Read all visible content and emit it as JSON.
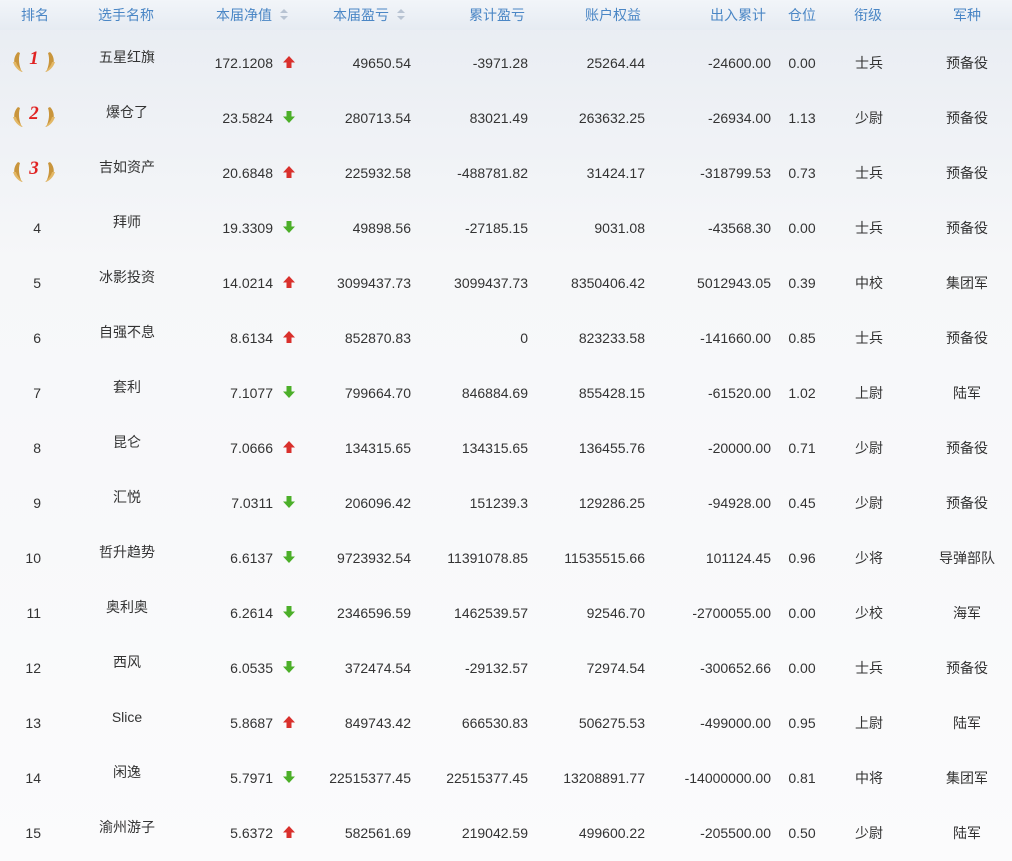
{
  "headers": {
    "rank": "排名",
    "name": "选手名称",
    "nav": "本届净值",
    "pnl": "本届盈亏",
    "cum": "累计盈亏",
    "equity": "账户权益",
    "flow": "出入累计",
    "position": "仓位",
    "grade": "衔级",
    "branch": "军种"
  },
  "colors": {
    "header_text": "#4a86c5",
    "up_arrow": "#d9302c",
    "down_arrow": "#4caf29",
    "medal_number": "#e02222"
  },
  "rows": [
    {
      "rank": "1",
      "name": "五星红旗",
      "nav": "172.1208",
      "trend": "up",
      "pnl": "49650.54",
      "cum": "-3971.28",
      "equity": "25264.44",
      "flow": "-24600.00",
      "position": "0.00",
      "grade": "士兵",
      "branch": "预备役"
    },
    {
      "rank": "2",
      "name": "爆仓了",
      "nav": "23.5824",
      "trend": "down",
      "pnl": "280713.54",
      "cum": "83021.49",
      "equity": "263632.25",
      "flow": "-26934.00",
      "position": "1.13",
      "grade": "少尉",
      "branch": "预备役"
    },
    {
      "rank": "3",
      "name": "吉如资产",
      "nav": "20.6848",
      "trend": "up",
      "pnl": "225932.58",
      "cum": "-488781.82",
      "equity": "31424.17",
      "flow": "-318799.53",
      "position": "0.73",
      "grade": "士兵",
      "branch": "预备役"
    },
    {
      "rank": "4",
      "name": "拜师",
      "nav": "19.3309",
      "trend": "down",
      "pnl": "49898.56",
      "cum": "-27185.15",
      "equity": "9031.08",
      "flow": "-43568.30",
      "position": "0.00",
      "grade": "士兵",
      "branch": "预备役"
    },
    {
      "rank": "5",
      "name": "冰影投资",
      "nav": "14.0214",
      "trend": "up",
      "pnl": "3099437.73",
      "cum": "3099437.73",
      "equity": "8350406.42",
      "flow": "5012943.05",
      "position": "0.39",
      "grade": "中校",
      "branch": "集团军"
    },
    {
      "rank": "6",
      "name": "自强不息",
      "nav": "8.6134",
      "trend": "up",
      "pnl": "852870.83",
      "cum": "0",
      "equity": "823233.58",
      "flow": "-141660.00",
      "position": "0.85",
      "grade": "士兵",
      "branch": "预备役"
    },
    {
      "rank": "7",
      "name": "套利",
      "nav": "7.1077",
      "trend": "down",
      "pnl": "799664.70",
      "cum": "846884.69",
      "equity": "855428.15",
      "flow": "-61520.00",
      "position": "1.02",
      "grade": "上尉",
      "branch": "陆军"
    },
    {
      "rank": "8",
      "name": "昆仑",
      "nav": "7.0666",
      "trend": "up",
      "pnl": "134315.65",
      "cum": "134315.65",
      "equity": "136455.76",
      "flow": "-20000.00",
      "position": "0.71",
      "grade": "少尉",
      "branch": "预备役"
    },
    {
      "rank": "9",
      "name": "汇悦",
      "nav": "7.0311",
      "trend": "down",
      "pnl": "206096.42",
      "cum": "151239.3",
      "equity": "129286.25",
      "flow": "-94928.00",
      "position": "0.45",
      "grade": "少尉",
      "branch": "预备役"
    },
    {
      "rank": "10",
      "name": "哲升趋势",
      "nav": "6.6137",
      "trend": "down",
      "pnl": "9723932.54",
      "cum": "11391078.85",
      "equity": "11535515.66",
      "flow": "101124.45",
      "position": "0.96",
      "grade": "少将",
      "branch": "导弹部队"
    },
    {
      "rank": "11",
      "name": "奥利奥",
      "nav": "6.2614",
      "trend": "down",
      "pnl": "2346596.59",
      "cum": "1462539.57",
      "equity": "92546.70",
      "flow": "-2700055.00",
      "position": "0.00",
      "grade": "少校",
      "branch": "海军"
    },
    {
      "rank": "12",
      "name": "西风",
      "nav": "6.0535",
      "trend": "down",
      "pnl": "372474.54",
      "cum": "-29132.57",
      "equity": "72974.54",
      "flow": "-300652.66",
      "position": "0.00",
      "grade": "士兵",
      "branch": "预备役"
    },
    {
      "rank": "13",
      "name": "Slice",
      "nav": "5.8687",
      "trend": "up",
      "pnl": "849743.42",
      "cum": "666530.83",
      "equity": "506275.53",
      "flow": "-499000.00",
      "position": "0.95",
      "grade": "上尉",
      "branch": "陆军"
    },
    {
      "rank": "14",
      "name": "闲逸",
      "nav": "5.7971",
      "trend": "down",
      "pnl": "22515377.45",
      "cum": "22515377.45",
      "equity": "13208891.77",
      "flow": "-14000000.00",
      "position": "0.81",
      "grade": "中将",
      "branch": "集团军"
    },
    {
      "rank": "15",
      "name": "渝州游子",
      "nav": "5.6372",
      "trend": "up",
      "pnl": "582561.69",
      "cum": "219042.59",
      "equity": "499600.22",
      "flow": "-205500.00",
      "position": "0.50",
      "grade": "少尉",
      "branch": "陆军"
    }
  ]
}
